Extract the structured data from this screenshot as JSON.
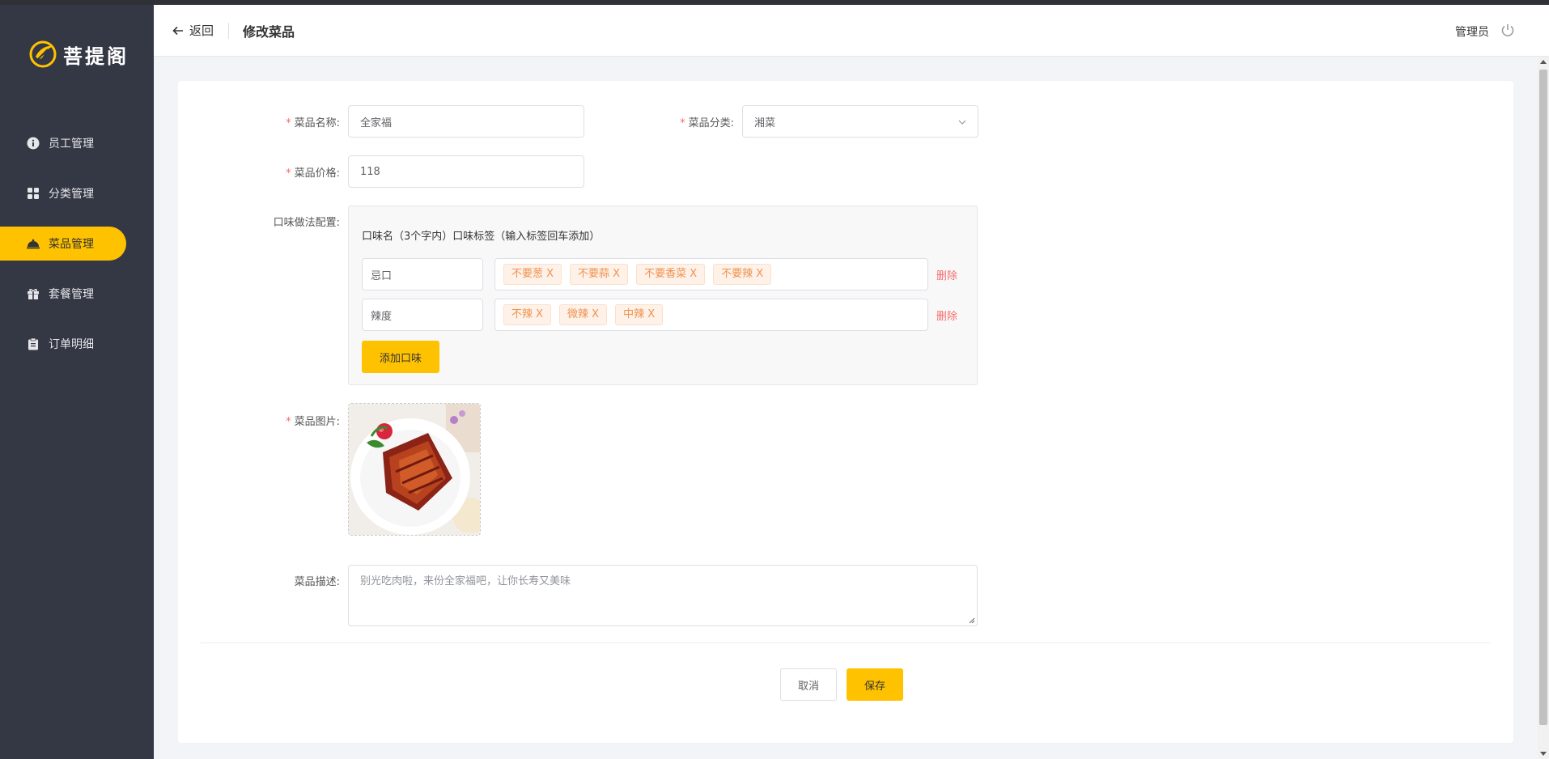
{
  "app": {
    "name": "菩提阁",
    "brand_color": "#ffc200",
    "sidebar_color": "#343744"
  },
  "sidebar": {
    "items": [
      {
        "label": "员工管理",
        "icon": "info-circle-icon",
        "active": false
      },
      {
        "label": "分类管理",
        "icon": "grid-icon",
        "active": false
      },
      {
        "label": "菜品管理",
        "icon": "cloche-icon",
        "active": true
      },
      {
        "label": "套餐管理",
        "icon": "gift-icon",
        "active": false
      },
      {
        "label": "订单明细",
        "icon": "clipboard-icon",
        "active": false
      }
    ]
  },
  "header": {
    "back_label": "返回",
    "title": "修改菜品",
    "user": "管理员",
    "logout_icon": "power-icon"
  },
  "form": {
    "name": {
      "label": "菜品名称:",
      "value": "全家福"
    },
    "category": {
      "label": "菜品分类:",
      "value": "湘菜"
    },
    "price": {
      "label": "菜品价格:",
      "value": "118"
    },
    "flavors": {
      "label": "口味做法配置:",
      "header": "口味名（3个字内）口味标签（输入标签回车添加）",
      "rows": [
        {
          "name": "忌口",
          "tags": [
            "不要葱 X",
            "不要蒜 X",
            "不要香菜 X",
            "不要辣 X"
          ],
          "delete": "删除"
        },
        {
          "name": "辣度",
          "tags": [
            "不辣 X",
            "微辣 X",
            "中辣 X"
          ],
          "delete": "删除"
        }
      ],
      "add_label": "添加口味"
    },
    "image": {
      "label": "菜品图片:"
    },
    "description": {
      "label": "菜品描述:",
      "placeholder": "别光吃肉啦，来份全家福吧，让你长寿又美味"
    },
    "cancel_label": "取消",
    "save_label": "保存"
  }
}
